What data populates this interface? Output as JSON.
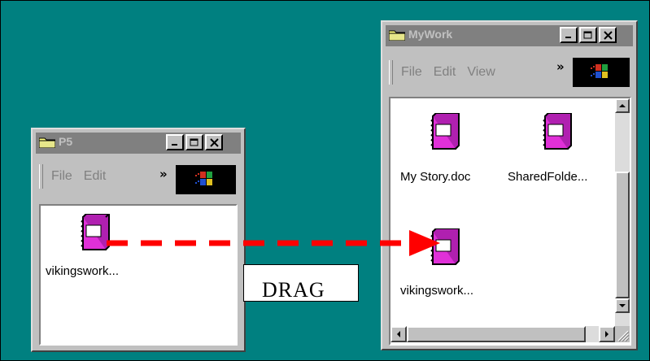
{
  "windows": {
    "p5": {
      "title": "P5",
      "menu": [
        "File",
        "Edit"
      ],
      "menu_underline": [
        "F",
        "E"
      ],
      "chevron": "»",
      "files": [
        {
          "label": "vikingswork...",
          "icon": "book-file-icon"
        }
      ]
    },
    "mywork": {
      "title": "MyWork",
      "menu": [
        "File",
        "Edit",
        "View"
      ],
      "chevron": "»",
      "files": [
        {
          "label": "My Story.doc",
          "icon": "book-file-icon"
        },
        {
          "label": "SharedFolde...",
          "icon": "book-file-icon"
        },
        {
          "label": "vikingswork...",
          "icon": "book-file-icon"
        }
      ]
    }
  },
  "annotation": {
    "label": "DRAG"
  },
  "colors": {
    "desktop": "#008080",
    "title_inactive": "#808080",
    "window": "#c0c0c0",
    "book": "#e030d8",
    "arrow": "#ff0000"
  },
  "title_buttons": [
    "minimize-icon",
    "maximize-icon",
    "close-icon"
  ]
}
